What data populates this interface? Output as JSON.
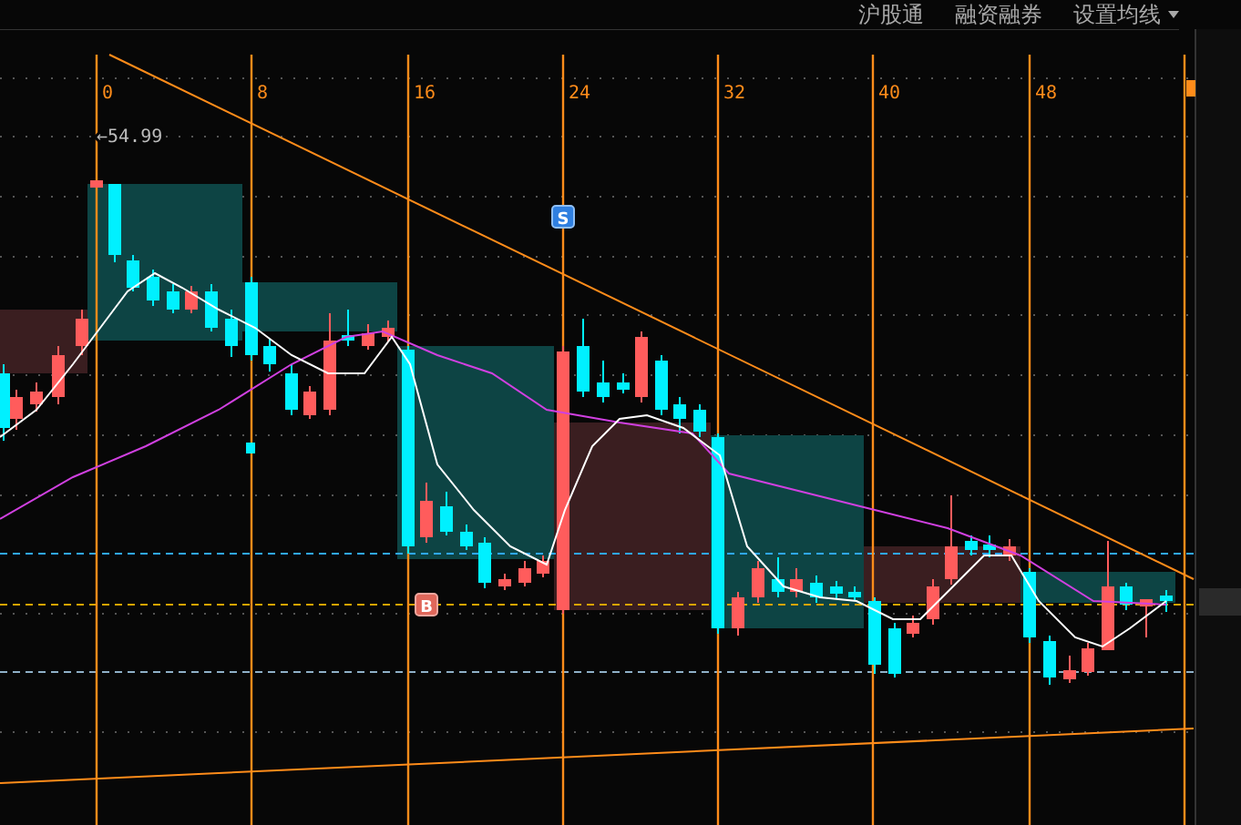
{
  "top_menu": [
    {
      "label": "沪股通"
    },
    {
      "label": "融资融券"
    },
    {
      "label": "设置均线",
      "dropdown": true
    }
  ],
  "cycle_markers": [
    {
      "label": "0"
    },
    {
      "label": "8"
    },
    {
      "label": "16"
    },
    {
      "label": "24"
    },
    {
      "label": "32"
    },
    {
      "label": "40"
    },
    {
      "label": "48"
    }
  ],
  "price_marker": "←54.99",
  "signals": [
    {
      "label": "S",
      "kind": "sell"
    },
    {
      "label": "B",
      "kind": "buy"
    }
  ]
}
